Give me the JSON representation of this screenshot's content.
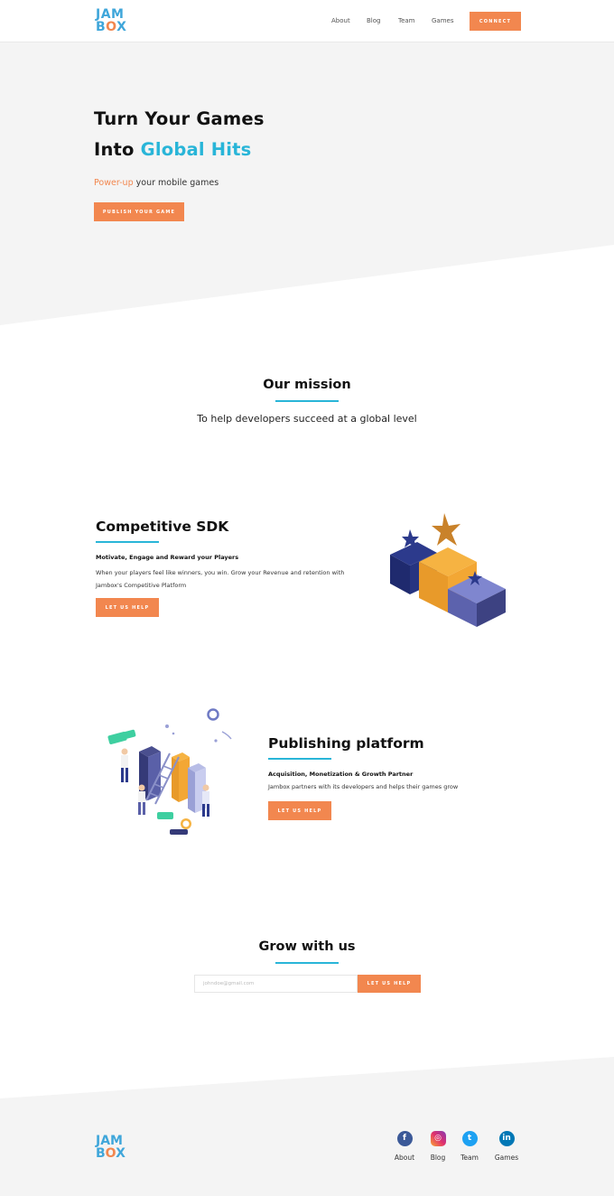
{
  "header": {
    "logo_top": "JAM",
    "logo_bottom_a": "B",
    "logo_bottom_o": "O",
    "logo_bottom_x": "X",
    "nav": [
      "About",
      "Blog",
      "Team",
      "Games"
    ],
    "connect_label": "CONNECT"
  },
  "hero": {
    "title_line1": "Turn Your Games",
    "title_line2_prefix": "Into ",
    "title_line2_highlight": "Global Hits",
    "subtitle_accent": "Power-up",
    "subtitle_rest": " your mobile games",
    "cta_label": "PUBLISH YOUR GAME"
  },
  "mission": {
    "title": "Our mission",
    "text": "To help developers succeed at a global level"
  },
  "sdk": {
    "title": "Competitive SDK",
    "bold": "Motivate, Engage and Reward your Players",
    "text": "When your players feel like winners, you win. Grow your Revenue and retention with Jambox's Competitive Platform",
    "cta_label": "LET US HELP"
  },
  "publishing": {
    "title": "Publishing platform",
    "bold": "Acquisition, Monetization &  Growth Partner",
    "text": "Jambox partners with its developers and helps their games grow",
    "cta_label": "LET US HELP"
  },
  "grow": {
    "title": "Grow with us",
    "email_placeholder": "johndoe@gmail.com",
    "cta_label": "LET US HELP"
  },
  "footer": {
    "social": [
      {
        "label": "About",
        "icon": "facebook-icon",
        "glyph": "f"
      },
      {
        "label": "Blog",
        "icon": "instagram-icon",
        "glyph": "◎"
      },
      {
        "label": "Team",
        "icon": "twitter-icon",
        "glyph": "t"
      },
      {
        "label": "Games",
        "icon": "linkedin-icon",
        "glyph": "in"
      }
    ]
  },
  "colors": {
    "accent": "#f2874f",
    "brand_blue": "#29b5d8",
    "hero_bg": "#f4f4f4"
  }
}
